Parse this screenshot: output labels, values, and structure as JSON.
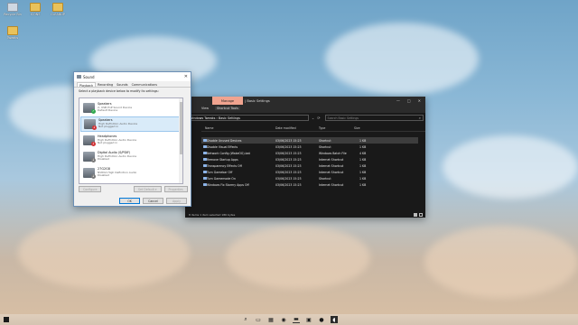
{
  "desktop": {
    "icons": [
      {
        "label": "Recycle Bin"
      },
      {
        "label": "ICONS"
      },
      {
        "label": "CLEANUP"
      },
      {
        "label": "Tweaks"
      }
    ]
  },
  "sound_dialog": {
    "title": "Sound",
    "close_glyph": "✕",
    "tabs": [
      "Playback",
      "Recording",
      "Sounds",
      "Communications"
    ],
    "instruction": "Select a playback device below to modify its settings:",
    "devices": [
      {
        "name": "Speakers",
        "line2": "2- USB PnP Sound Device",
        "status": "Default Device",
        "badge": "ok",
        "badge_glyph": "✓"
      },
      {
        "name": "Speakers",
        "line2": "High Definition Audio Device",
        "status": "Not plugged in",
        "badge": "down",
        "badge_glyph": "↓"
      },
      {
        "name": "Headphones",
        "line2": "High Definition Audio Device",
        "status": "Not plugged in",
        "badge": "down",
        "badge_glyph": "↓"
      },
      {
        "name": "Digital Audio (S/PDIF)",
        "line2": "High Definition Audio Device",
        "status": "Disabled",
        "badge": "dis",
        "badge_glyph": "↓"
      },
      {
        "name": "27G2G8",
        "line2": "NVIDIA High Definition Audio",
        "status": "Disabled",
        "badge": "dis",
        "badge_glyph": "↓"
      }
    ],
    "buttons": {
      "configure": "Configure",
      "set_default": "Set Default",
      "properties": "Properties",
      "ok": "OK",
      "cancel": "Cancel",
      "apply": "Apply"
    }
  },
  "explorer": {
    "manage_tab": "Manage",
    "window_title": "Basic Settings",
    "window_controls": [
      "—",
      "□",
      "✕"
    ],
    "ribbon": {
      "view": "View",
      "shortcut_tools": "Shortcut Tools"
    },
    "nav": {
      "back": "‹",
      "refresh": "⟳"
    },
    "address": "Windows Tweaks  ›  Basic Settings",
    "search_placeholder": "Search Basic Settings",
    "search_glyph": "⌕",
    "columns": {
      "name": "Name",
      "date": "Date modified",
      "type": "Type",
      "size": "Size"
    },
    "files": [
      {
        "name": "Disable Unused Devices",
        "date": "03/06/2023 15:23",
        "type": "Shortcut",
        "size": "1 KB",
        "selected": true
      },
      {
        "name": "Disable Visual Effects",
        "date": "03/06/2023 15:23",
        "type": "Shortcut",
        "size": "1 KB",
        "selected": false
      },
      {
        "name": "Network Config (WakeOG).bat",
        "date": "03/06/2023 15:23",
        "type": "Windows Batch File",
        "size": "4 KB",
        "selected": false
      },
      {
        "name": "Remove Startup Apps",
        "date": "03/06/2023 15:23",
        "type": "Internet Shortcut",
        "size": "1 KB",
        "selected": false
      },
      {
        "name": "Transparency Effects Off",
        "date": "03/06/2023 15:23",
        "type": "Internet Shortcut",
        "size": "1 KB",
        "selected": false
      },
      {
        "name": "Turn Gamebar Off",
        "date": "03/06/2023 15:23",
        "type": "Internet Shortcut",
        "size": "1 KB",
        "selected": false
      },
      {
        "name": "Turn Gamemode On",
        "date": "03/06/2023 15:23",
        "type": "Shortcut",
        "size": "1 KB",
        "selected": false
      },
      {
        "name": "Windows Fix Stormy Apps Off",
        "date": "03/06/2023 15:23",
        "type": "Internet Shortcut",
        "size": "1 KB",
        "selected": false
      }
    ],
    "status": "8 items   1 item selected  186 bytes"
  },
  "taskbar": {
    "icons": [
      {
        "name": "search-icon",
        "glyph": "⌕"
      },
      {
        "name": "task-view-icon",
        "glyph": "▭"
      },
      {
        "name": "widgets-icon",
        "glyph": "▦"
      },
      {
        "name": "edge-icon",
        "glyph": "◉"
      },
      {
        "name": "file-explorer-icon",
        "glyph": "▬"
      },
      {
        "name": "store-icon",
        "glyph": "▣"
      },
      {
        "name": "steam-icon",
        "glyph": "●"
      },
      {
        "name": "sound-icon",
        "glyph": "◖"
      }
    ]
  }
}
